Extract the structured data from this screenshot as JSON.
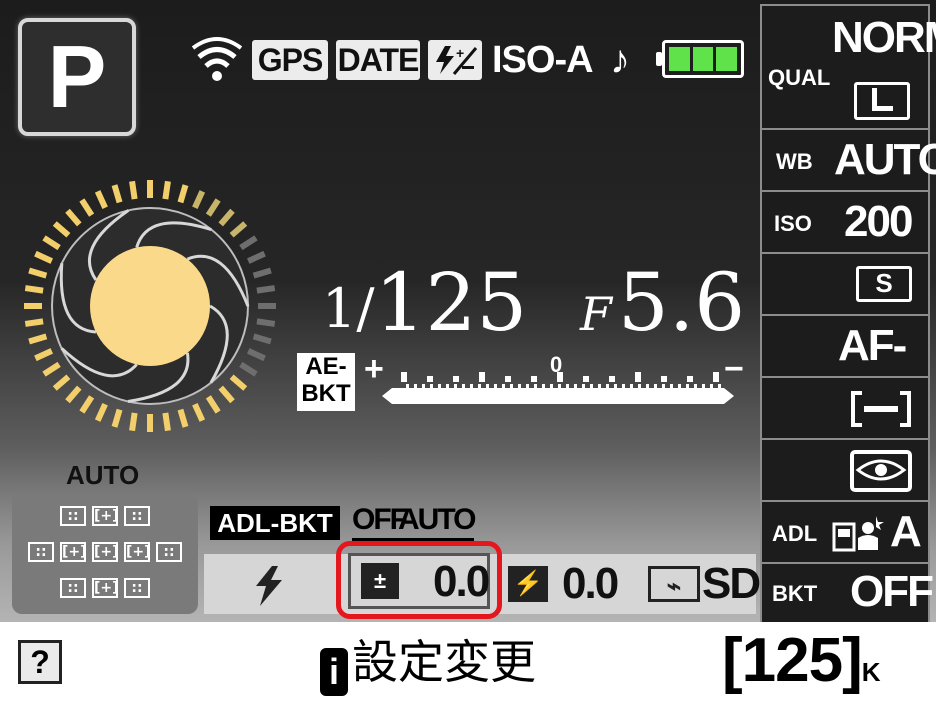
{
  "shooting_mode": "P",
  "status_icons": {
    "wifi": "wifi-icon",
    "gps": "GPS",
    "date": "DATE",
    "flash_comp_icon": "flash-compensation-icon",
    "iso_auto": "ISO-A",
    "beep": "♪",
    "battery_level": 1.0
  },
  "exposure": {
    "shutter_num": "1",
    "shutter_den": "125",
    "f_prefix": "F",
    "aperture": "5.6",
    "bracket_label_1": "AE-",
    "bracket_label_2": "BKT",
    "meter_plus": "+",
    "meter_minus": "−",
    "meter_zero": "0"
  },
  "right_panel": {
    "qual_label": "QUAL",
    "qual_value": "NORM",
    "image_size": "L",
    "wb_label": "WB",
    "wb_value": "AUTO",
    "iso_label": "ISO",
    "iso_value": "200",
    "release_mode": "S",
    "af_mode": "AF-A",
    "af_area_icon": "af-area-icon",
    "metering_icon": "metering-icon",
    "adl_label": "ADL",
    "adl_value": "A",
    "bkt_label": "BKT",
    "bkt_value": "OFF"
  },
  "af_points": {
    "mode_label": "AUTO"
  },
  "adl_bracket": {
    "label": "ADL-BKT",
    "off": "OFF",
    "auto": "AUTO"
  },
  "bottom_bar": {
    "flash_icon": "flash-mode-icon",
    "exposure_comp_icon": "exposure-compensation-icon",
    "exposure_comp_value": "0.0",
    "flash_comp_icon": "flash-compensation-icon",
    "flash_comp_value": "0.0",
    "picture_control_icon": "picture-control-icon",
    "picture_control_value": "SD"
  },
  "footer": {
    "help": "?",
    "setting_change": "設定変更",
    "shots_remaining": "125",
    "shots_unit": "K"
  },
  "colors": {
    "highlight": "#e3171d",
    "battery": "#5fe24a",
    "aperture_dial": "#fad98a"
  }
}
